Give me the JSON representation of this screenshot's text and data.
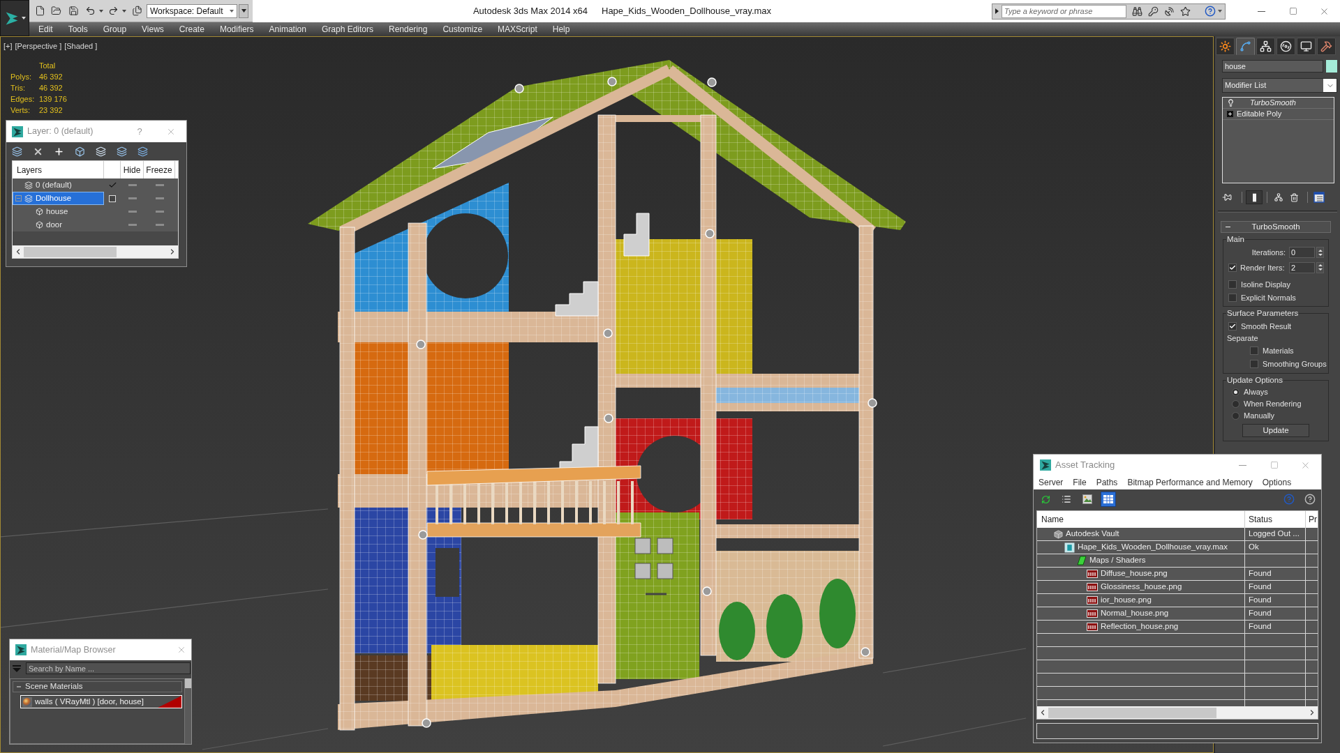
{
  "title_bar": {
    "workspace": "Workspace: Default",
    "app_title": "Autodesk 3ds Max 2014 x64",
    "file_name": "Hape_Kids_Wooden_Dollhouse_vray.max",
    "search": {
      "placeholder": "Type a keyword or phrase"
    }
  },
  "menu_bar": [
    "Edit",
    "Tools",
    "Group",
    "Views",
    "Create",
    "Modifiers",
    "Animation",
    "Graph Editors",
    "Rendering",
    "Customize",
    "MAXScript",
    "Help"
  ],
  "viewport": {
    "labels": [
      "[+]",
      "[Perspective ]",
      "[Shaded ]"
    ],
    "stats": {
      "header": "Total",
      "rows": [
        {
          "label": "Polys:",
          "value": "46 392"
        },
        {
          "label": "Tris:",
          "value": "46 392"
        },
        {
          "label": "Edges:",
          "value": "139 176"
        },
        {
          "label": "Verts:",
          "value": "23 392"
        }
      ]
    }
  },
  "layer_manager": {
    "title": "Layer: 0 (default)",
    "help": "?",
    "columns": [
      "Layers",
      "Hide",
      "Freeze"
    ],
    "layers": [
      {
        "kind": "layer",
        "name": "0 (default)",
        "selected": false,
        "current": true,
        "hidden": false,
        "frozen": false
      },
      {
        "kind": "layer",
        "name": "Dollhouse",
        "selected": true,
        "current": false,
        "expanded": true,
        "hidden": false,
        "frozen": false,
        "children": [
          {
            "kind": "object",
            "name": "house",
            "selected": false,
            "hidden": false,
            "frozen": false
          },
          {
            "kind": "object",
            "name": "door",
            "selected": false,
            "hidden": false,
            "frozen": false
          }
        ]
      }
    ]
  },
  "material_browser": {
    "title": "Material/Map Browser",
    "search": {
      "placeholder": "Search by Name ..."
    },
    "groups": [
      {
        "name": "Scene Materials",
        "expanded": true,
        "items": [
          {
            "name": "walls ( VRayMtl ) [door, house]",
            "selected": true
          }
        ]
      }
    ]
  },
  "command_panel": {
    "tabs": [
      {
        "selected": false
      },
      {
        "selected": true
      },
      {
        "selected": false
      },
      {
        "selected": false
      },
      {
        "selected": false
      },
      {
        "selected": false
      }
    ],
    "object_name": "house",
    "modifier_list": "Modifier List",
    "modifier_stack": [
      {
        "kind": "modifier",
        "name": "TurboSmooth"
      },
      {
        "kind": "base",
        "name": "Editable Poly",
        "expanded": false
      }
    ],
    "rollout": {
      "title": "TurboSmooth",
      "expanded": true,
      "groups": [
        {
          "title": "Main",
          "controls": [
            {
              "kind": "spinner",
              "label": "Iterations:",
              "value": "0"
            },
            {
              "kind": "check_spinner",
              "label": "Render Iters:",
              "checked": true,
              "value": "2"
            },
            {
              "kind": "checkbox",
              "label": "Isoline Display",
              "checked": false
            },
            {
              "kind": "checkbox",
              "label": "Explicit Normals",
              "checked": false
            }
          ]
        },
        {
          "title": "Surface Parameters",
          "controls": [
            {
              "kind": "checkbox",
              "label": "Smooth Result",
              "checked": true
            },
            {
              "kind": "label",
              "label": "Separate",
              "children": [
                {
                  "kind": "checkbox",
                  "label": "Materials",
                  "checked": false
                },
                {
                  "kind": "checkbox",
                  "label": "Smoothing Groups",
                  "checked": false
                }
              ]
            }
          ]
        },
        {
          "title": "Update Options",
          "controls": [
            {
              "kind": "radio",
              "label": "Always",
              "selected": true
            },
            {
              "kind": "radio",
              "label": "When Rendering",
              "selected": false
            },
            {
              "kind": "radio",
              "label": "Manually",
              "selected": false
            },
            {
              "kind": "button",
              "label": "Update"
            }
          ]
        }
      ]
    }
  },
  "asset_tracking": {
    "title": "Asset Tracking",
    "menu": [
      "Server",
      "File",
      "Paths",
      "Bitmap Performance and Memory",
      "Options"
    ],
    "toolbar": [
      {
        "selected": false
      },
      {
        "selected": false
      },
      {
        "selected": false
      },
      {
        "selected": true
      }
    ],
    "columns": [
      "Name",
      "Status",
      "Pr"
    ],
    "assets": [
      {
        "kind": "vault",
        "name": "Autodesk Vault",
        "status": "Logged Out ...",
        "children": [
          {
            "kind": "scene",
            "name": "Hape_Kids_Wooden_Dollhouse_vray.max",
            "status": "Ok",
            "children": [
              {
                "kind": "folder",
                "name": "Maps / Shaders",
                "children": [
                  {
                    "kind": "png",
                    "name": "Diffuse_house.png",
                    "status": "Found"
                  },
                  {
                    "kind": "png",
                    "name": "Glossiness_house.png",
                    "status": "Found"
                  },
                  {
                    "kind": "png",
                    "name": "ior_house.png",
                    "status": "Found"
                  },
                  {
                    "kind": "png",
                    "name": "Normal_house.png",
                    "status": "Found"
                  },
                  {
                    "kind": "png",
                    "name": "Reflection_house.png",
                    "status": "Found"
                  }
                ]
              }
            ]
          }
        ]
      }
    ]
  }
}
